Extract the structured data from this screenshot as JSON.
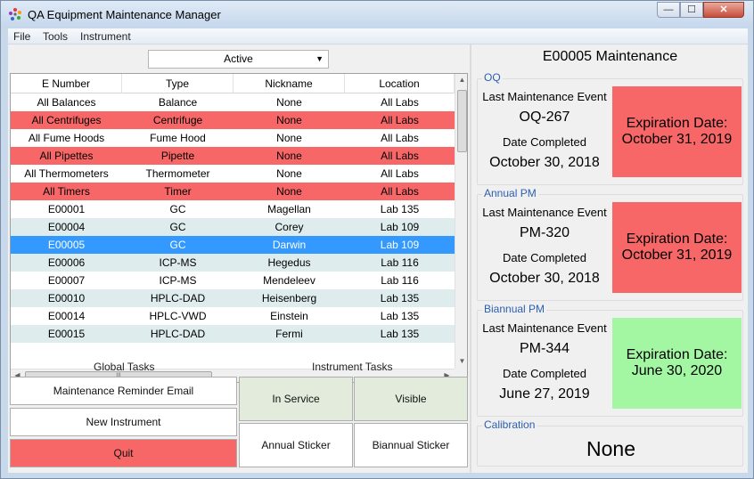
{
  "window": {
    "title": "QA Equipment Maintenance Manager",
    "min_glyph": "—",
    "max_glyph": "☐",
    "close_glyph": "✕"
  },
  "menu": [
    "File",
    "Tools",
    "Instrument"
  ],
  "filter": {
    "selected": "Active"
  },
  "table": {
    "columns": [
      "E Number",
      "Type",
      "Nickname",
      "Location"
    ],
    "rows": [
      {
        "cells": [
          "All Balances",
          "Balance",
          "None",
          "All Labs"
        ],
        "style": "white"
      },
      {
        "cells": [
          "All Centrifuges",
          "Centrifuge",
          "None",
          "All Labs"
        ],
        "style": "red"
      },
      {
        "cells": [
          "All Fume Hoods",
          "Fume Hood",
          "None",
          "All Labs"
        ],
        "style": "white"
      },
      {
        "cells": [
          "All Pipettes",
          "Pipette",
          "None",
          "All Labs"
        ],
        "style": "red"
      },
      {
        "cells": [
          "All Thermometers",
          "Thermometer",
          "None",
          "All Labs"
        ],
        "style": "white"
      },
      {
        "cells": [
          "All Timers",
          "Timer",
          "None",
          "All Labs"
        ],
        "style": "red"
      },
      {
        "cells": [
          "E00001",
          "GC",
          "Magellan",
          "Lab 135"
        ],
        "style": "white"
      },
      {
        "cells": [
          "E00004",
          "GC",
          "Corey",
          "Lab 109"
        ],
        "style": "alt"
      },
      {
        "cells": [
          "E00005",
          "GC",
          "Darwin",
          "Lab 109"
        ],
        "style": "selected"
      },
      {
        "cells": [
          "E00006",
          "ICP-MS",
          "Hegedus",
          "Lab 116"
        ],
        "style": "alt"
      },
      {
        "cells": [
          "E00007",
          "ICP-MS",
          "Mendeleev",
          "Lab 116"
        ],
        "style": "white"
      },
      {
        "cells": [
          "E00010",
          "HPLC-DAD",
          "Heisenberg",
          "Lab 135"
        ],
        "style": "alt"
      },
      {
        "cells": [
          "E00014",
          "HPLC-VWD",
          "Einstein",
          "Lab 135"
        ],
        "style": "white"
      },
      {
        "cells": [
          "E00015",
          "HPLC-DAD",
          "Fermi",
          "Lab 135"
        ],
        "style": "alt"
      }
    ]
  },
  "global_tasks": {
    "label": "Global Tasks",
    "reminder": "Maintenance Reminder Email",
    "new_instrument": "New Instrument",
    "quit": "Quit"
  },
  "instrument_tasks": {
    "label": "Instrument Tasks",
    "in_service": "In Service",
    "visible": "Visible",
    "annual_sticker": "Annual Sticker",
    "biannual_sticker": "Biannual Sticker"
  },
  "detail": {
    "title": "E00005 Maintenance",
    "sections": [
      {
        "caption": "OQ",
        "last_label": "Last Maintenance Event",
        "event": "OQ-267",
        "completed_label": "Date Completed",
        "completed": "October 30, 2018",
        "exp_label": "Expiration Date:",
        "exp_date": "October 31, 2019",
        "status": "expired"
      },
      {
        "caption": "Annual PM",
        "last_label": "Last Maintenance Event",
        "event": "PM-320",
        "completed_label": "Date Completed",
        "completed": "October 30, 2018",
        "exp_label": "Expiration Date:",
        "exp_date": "October 31, 2019",
        "status": "expired"
      },
      {
        "caption": "Biannual PM",
        "last_label": "Last Maintenance Event",
        "event": "PM-344",
        "completed_label": "Date Completed",
        "completed": "June 27, 2019",
        "exp_label": "Expiration Date:",
        "exp_date": "June 30, 2020",
        "status": "valid"
      }
    ],
    "calibration": {
      "caption": "Calibration",
      "value": "None"
    }
  },
  "colors": {
    "expired": "#f76767",
    "valid": "#a3f7a3",
    "selected": "#3399ff",
    "alt_row": "#deecee",
    "red_row": "#f76767",
    "white_row": "#ffffff"
  }
}
